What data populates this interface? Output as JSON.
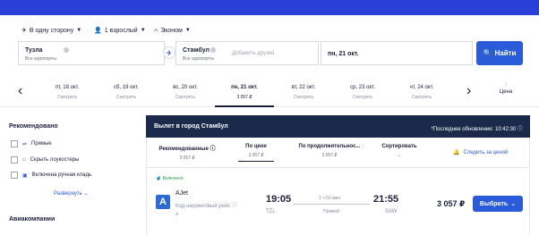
{
  "search": {
    "trip_type": "В одну сторону",
    "passengers": "1 взрослый",
    "cabin_class": "Эконом",
    "origin": {
      "city": "Тузла",
      "sub": "Все аэропорты"
    },
    "destination": {
      "city": "Стамбул",
      "sub": "Все аэропорты"
    },
    "add_friend": "Добавить друзей",
    "date": "пн, 21 окт.",
    "find_button": "Найти"
  },
  "date_bar": {
    "days": [
      {
        "date": "пт, 18 окт.",
        "price": "Смотреть",
        "active": false
      },
      {
        "date": "сб, 19 окт.",
        "price": "Смотреть",
        "active": false
      },
      {
        "date": "вс, 20 окт.",
        "price": "Смотреть",
        "active": false
      },
      {
        "date": "пн, 21 окт.",
        "price": "3 057 ₽",
        "active": true
      },
      {
        "date": "вт, 22 окт.",
        "price": "Смотреть",
        "active": false
      },
      {
        "date": "ср, 23 окт.",
        "price": "Смотреть",
        "active": false
      },
      {
        "date": "чт, 24 окт.",
        "price": "Смотреть",
        "active": false
      }
    ],
    "price_sort_label": "Цена"
  },
  "sidebar": {
    "recommended_title": "Рекомендовано",
    "filters": [
      {
        "label": "Прямые"
      },
      {
        "label": "Скрыть лоукостеры"
      },
      {
        "label": "Включена ручная кладь"
      }
    ],
    "expand_label": "Развернуть",
    "airlines_title": "Авиакомпании"
  },
  "results": {
    "header_title": "Вылет в город Стамбул",
    "last_update": "*Последнее обновление: 10:42:30",
    "tabs": [
      {
        "label": "Рекомендованные ⓘ",
        "price": "3 057 ₽"
      },
      {
        "label": "По цене",
        "price": "3 057 ₽"
      },
      {
        "label": "По продолжительнос...",
        "price": "3 057 ₽"
      },
      {
        "label": "Сортировать",
        "price": ""
      }
    ],
    "follow_price": "Следить за ценой",
    "flight": {
      "included": "Включено",
      "airline": "AJet",
      "codeshare": "Код-шеринговый рейс",
      "dep_time": "19:05",
      "dep_airport": "TZL",
      "duration": "1 ч 50 мин",
      "stops": "Прямой",
      "arr_time": "21:55",
      "arr_airport": "SAW",
      "price": "3 057 ₽",
      "choose_button": "Выбрать"
    }
  },
  "colors": {
    "brand": "#2a3fd8",
    "button": "#2a5bd8",
    "header_dark": "#1b2a4a"
  }
}
